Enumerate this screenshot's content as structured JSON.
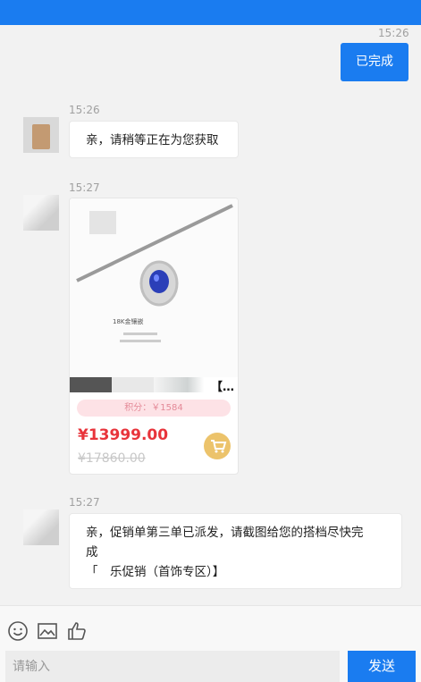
{
  "messages": {
    "m0_time": "15:26",
    "m0_text": "已完成",
    "m1_time": "15:26",
    "m1_text": "亲，请稍等正在为您获取",
    "m2_time": "15:27",
    "m3_time": "15:27",
    "m3_line1": "亲，促销单第三单已派发，请截图给您的搭档尽快完",
    "m3_line2": "成",
    "m3_line3": "「　乐促销（首饰专区）】"
  },
  "product": {
    "title_suffix": "【…",
    "points": "积分：￥1584",
    "price": "¥13999.00",
    "original_price": "¥17860.00",
    "image_caption": "18K金镶嵌"
  },
  "input_bar": {
    "placeholder": "请输入",
    "send_label": "发送"
  },
  "colors": {
    "primary": "#1a7cf0",
    "price": "#e8343b",
    "cart": "#ecc36b"
  }
}
